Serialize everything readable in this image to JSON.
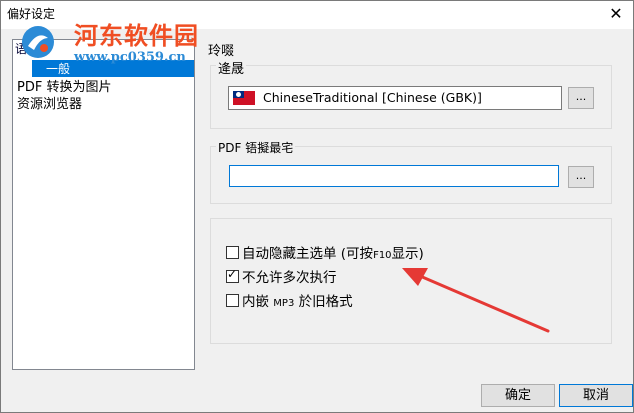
{
  "window": {
    "title": "偏好设定",
    "close_glyph": "✕"
  },
  "watermark": {
    "name": "河东软件园",
    "url": "www.pc0359.cn"
  },
  "tree": {
    "items": [
      {
        "label": "语言"
      },
      {
        "label": "一般",
        "selected": true
      },
      {
        "label": "PDF 转换为图片"
      },
      {
        "label": "资源浏览器"
      }
    ]
  },
  "language_section": {
    "heading": "玲啜",
    "group_label": "逄晟",
    "selected_language": "ChineseTraditional [Chinese (GBK)]",
    "flag_icon": "taiwan-flag-icon",
    "browse_label": "..."
  },
  "pdf_section": {
    "group_label": "PDF 铻擬最宅",
    "path_value": "",
    "browse_label": "..."
  },
  "options": [
    {
      "prefix": "自动隐藏主选单 (可按",
      "key": "F10",
      "suffix": "显示)",
      "checked": false
    },
    {
      "label": "不允许多次执行",
      "checked": true
    },
    {
      "prefix": "内嵌 ",
      "key": "MP3",
      "suffix": " 於旧格式",
      "checked": false
    }
  ],
  "buttons": {
    "ok": "确定",
    "cancel": "取消"
  },
  "colors": {
    "selection": "#0078d7",
    "annotation_arrow": "#e53935",
    "watermark_name": "#f04e23",
    "watermark_url": "#2c8bd6"
  }
}
